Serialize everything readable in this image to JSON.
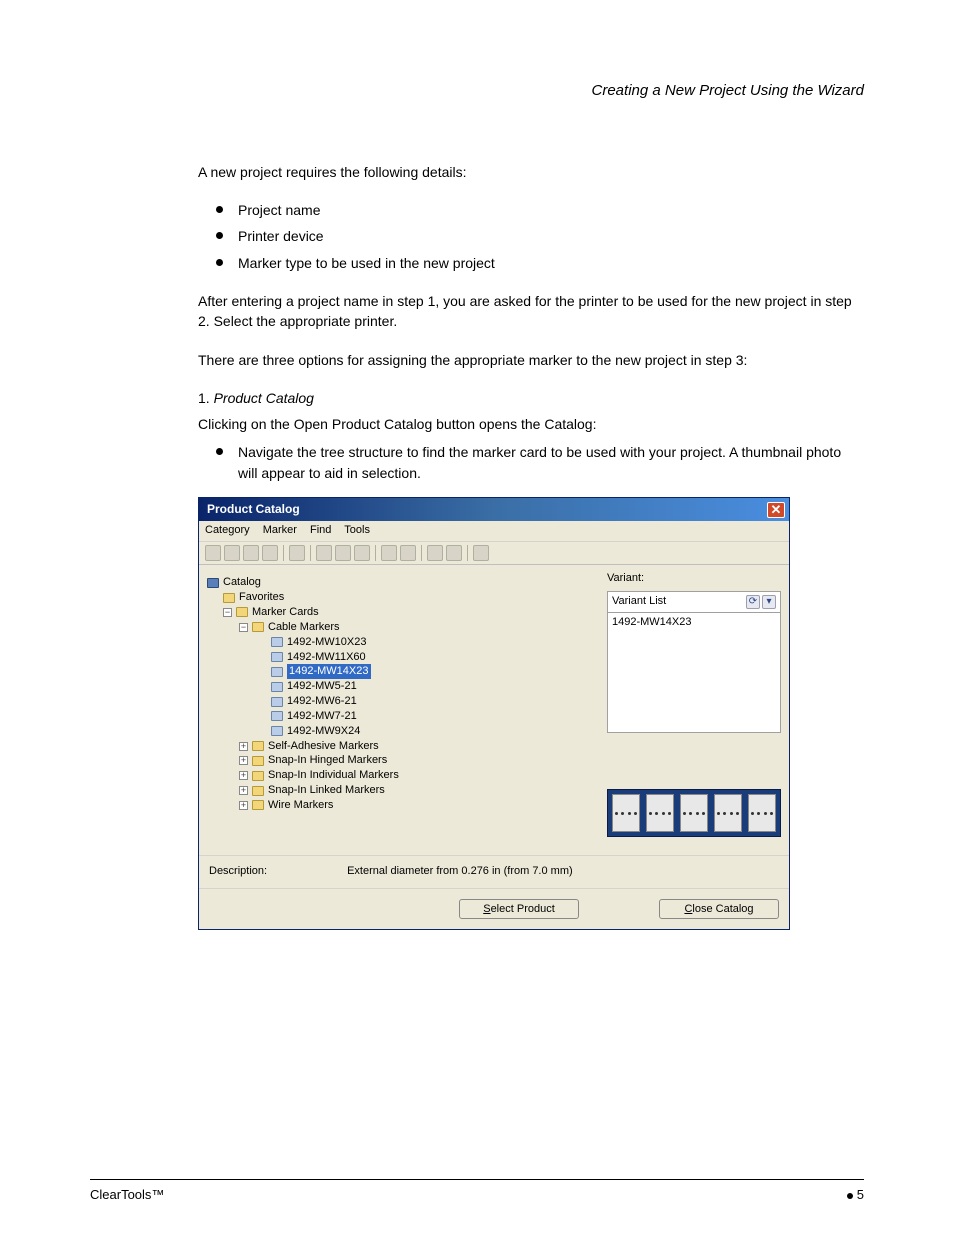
{
  "running_head": "Creating a New Project Using the Wizard",
  "intro": "A new project requires the following details:",
  "intro_bullets": [
    "Project name",
    "Printer device",
    "Marker type to be used in the new project"
  ],
  "para_printer": "After entering a project name in step 1, you are asked for the printer to be used for the new project in step 2. Select the appropriate printer.",
  "para_marker_intro": "There are three options for assigning the appropriate marker to the new project in step 3:",
  "step_1_lead": "1. ",
  "step_1_title": "Product Catalog",
  "step_1_body": "Clicking on the Open Product Catalog button opens the Catalog:",
  "step_1_bullets": [
    "Navigate the tree structure to find the marker card to be used with your project. A thumbnail photo will appear to aid in selection."
  ],
  "catalog": {
    "title": "Product Catalog",
    "menus": [
      "Category",
      "Marker",
      "Find",
      "Tools"
    ],
    "tree": {
      "root": "Catalog",
      "favorites": "Favorites",
      "marker_cards": "Marker Cards",
      "cable_markers": "Cable Markers",
      "items": [
        "1492-MW10X23",
        "1492-MW11X60",
        "1492-MW14X23",
        "1492-MW5-21",
        "1492-MW6-21",
        "1492-MW7-21",
        "1492-MW9X24"
      ],
      "selected": "1492-MW14X23",
      "folders": [
        "Self-Adhesive Markers",
        "Snap-In Hinged Markers",
        "Snap-In Individual Markers",
        "Snap-In Linked Markers",
        "Wire Markers"
      ]
    },
    "variant_label": "Variant:",
    "variant_list_label": "Variant List",
    "variant_value": "1492-MW14X23",
    "desc_label": "Description:",
    "desc_value": "External diameter from 0.276 in (from 7.0 mm)",
    "btn_select": "Select Product",
    "btn_close": "Close Catalog"
  },
  "footer_left": "ClearTools™",
  "footer_right": "5"
}
